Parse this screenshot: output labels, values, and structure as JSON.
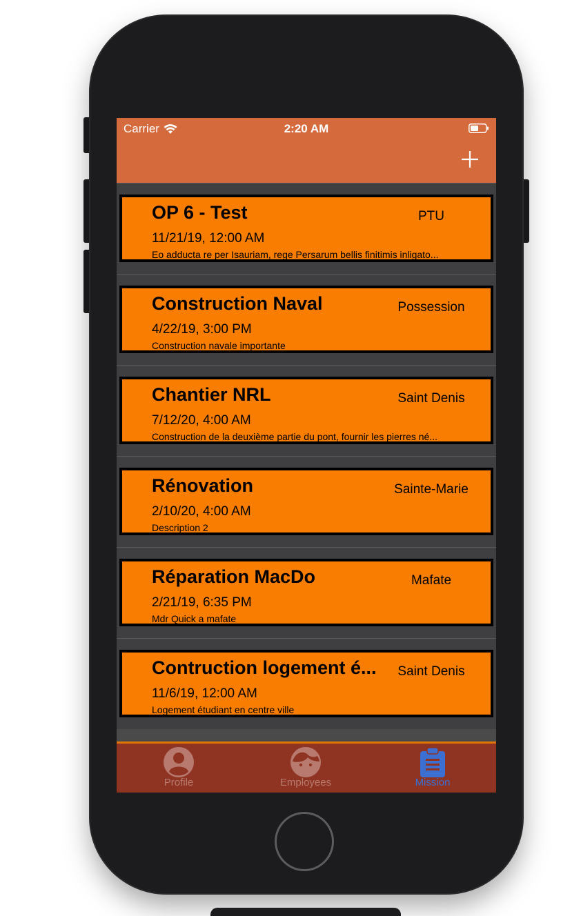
{
  "status_bar": {
    "carrier": "Carrier",
    "time": "2:20 AM"
  },
  "navbar": {
    "add_icon": "plus-icon"
  },
  "missions": [
    {
      "title": "OP 6 - Test",
      "location": "PTU",
      "date": "11/21/19, 12:00 AM",
      "description": "Eo adducta re per Isauriam, rege Persarum bellis finitimis inligato..."
    },
    {
      "title": "Construction Naval",
      "location": "Possession",
      "date": "4/22/19, 3:00 PM",
      "description": "Construction navale importante"
    },
    {
      "title": "Chantier NRL",
      "location": "Saint Denis",
      "date": "7/12/20, 4:00 AM",
      "description": "Construction de la deuxième partie du pont, fournir les pierres né..."
    },
    {
      "title": "Rénovation",
      "location": "Sainte-Marie",
      "date": "2/10/20, 4:00 AM",
      "description": "Description 2"
    },
    {
      "title": "Réparation MacDo",
      "location": "Mafate",
      "date": "2/21/19, 6:35 PM",
      "description": "Mdr Quick a mafate"
    },
    {
      "title": "Contruction logement é...",
      "location": "Saint Denis",
      "date": "11/6/19, 12:00 AM",
      "description": "Logement étudiant en centre ville"
    }
  ],
  "tabs": [
    {
      "label": "Profile",
      "icon": "profile-icon",
      "active": false
    },
    {
      "label": "Employees",
      "icon": "face-icon",
      "active": false
    },
    {
      "label": "Mission",
      "icon": "clipboard-icon",
      "active": true
    }
  ],
  "colors": {
    "navbar": "#d56a3c",
    "card": "#f97d00",
    "tabbar": "#8f3422",
    "tab_active": "#3d6fd1",
    "tab_inactive": "#b87a6f"
  }
}
